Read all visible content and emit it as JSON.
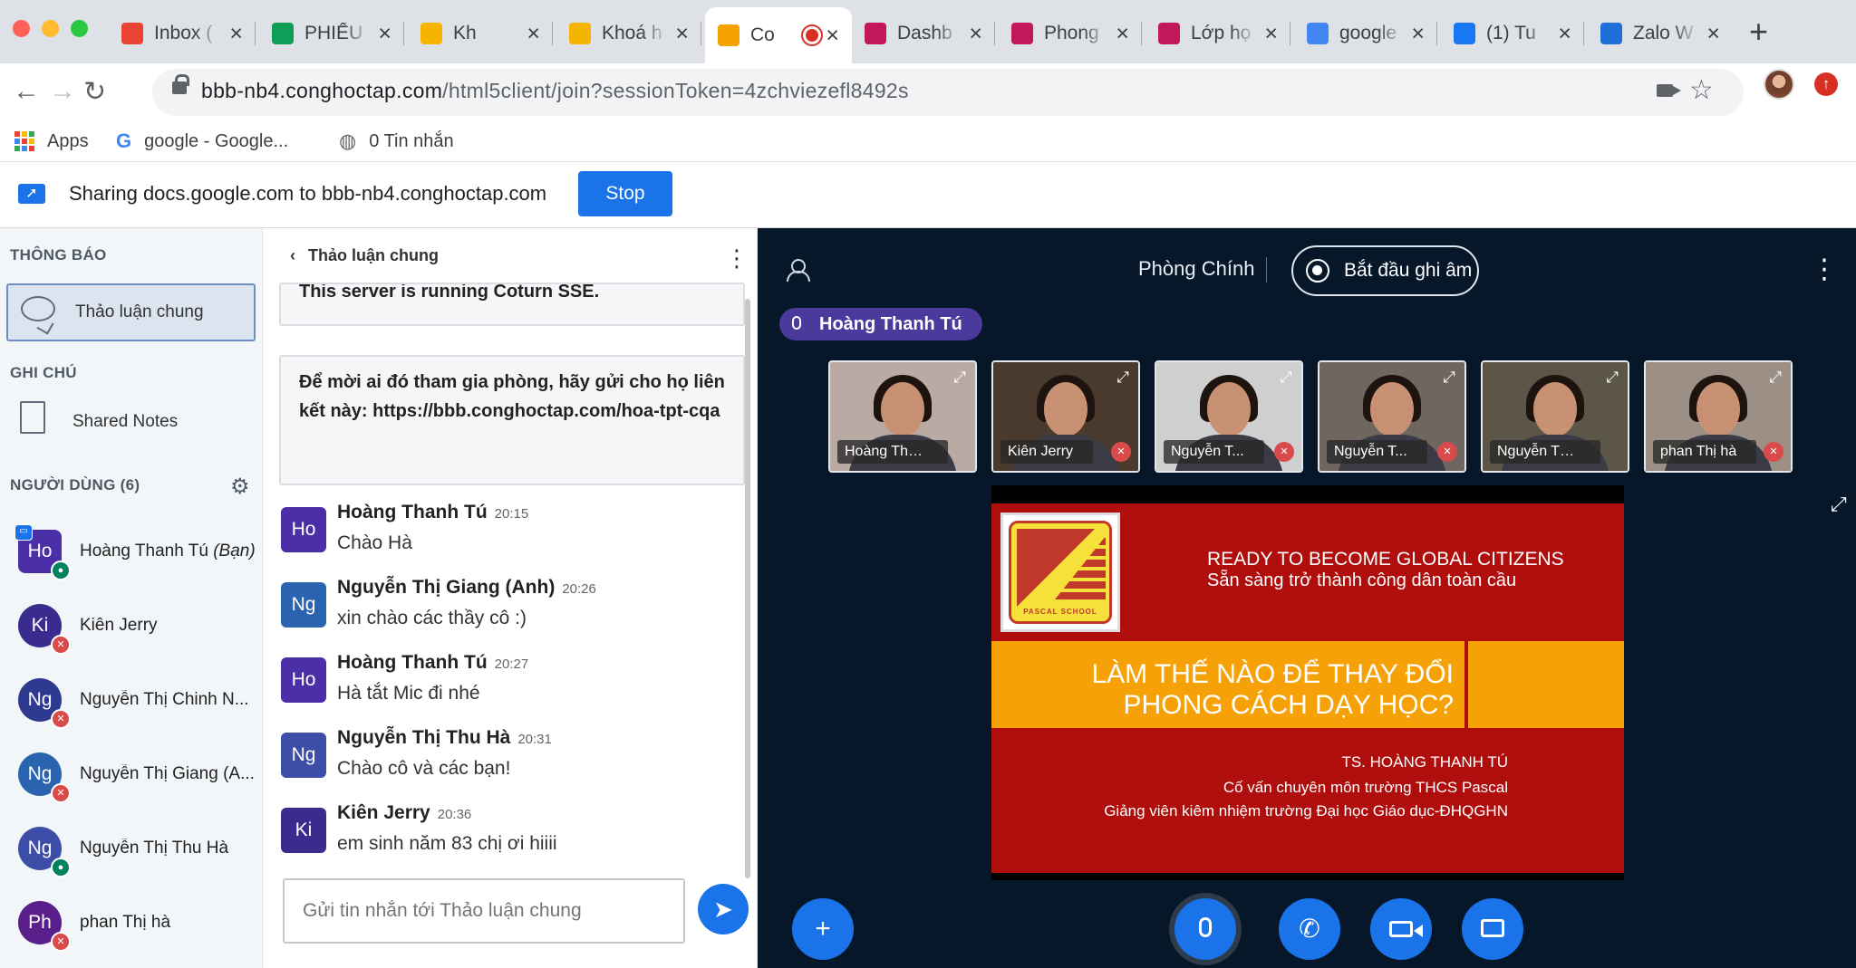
{
  "browser": {
    "tabs": [
      {
        "icon": "gmail-icon",
        "title": "Inbox (",
        "color": "#ea4335"
      },
      {
        "icon": "google-drive-icon",
        "title": "PHIẾU",
        "color": "#0f9d58"
      },
      {
        "icon": "google-slides-icon",
        "title": "Kh",
        "color": "#f4b400"
      },
      {
        "icon": "class-icon",
        "title": "Khoá h",
        "color": "#f4b400"
      },
      {
        "icon": "conghoctap-icon",
        "title": "Co",
        "color": "#f4a300",
        "active": true
      },
      {
        "icon": "dashboard-icon",
        "title": "Dashb",
        "color": "#c2185b"
      },
      {
        "icon": "room-icon",
        "title": "Phong",
        "color": "#c2185b"
      },
      {
        "icon": "class-room-icon",
        "title": "Lớp họ",
        "color": "#c2185b"
      },
      {
        "icon": "google-icon",
        "title": "google",
        "color": "#4285f4"
      },
      {
        "icon": "facebook-icon",
        "title": "(1) Tu",
        "color": "#1877f2"
      },
      {
        "icon": "zalo-icon",
        "title": "Zalo W",
        "color": "#1e6fd9"
      }
    ],
    "url_host": "bbb-nb4.conghoctap.com",
    "url_path": "/html5client/join?sessionToken=4zchviezefl8492s",
    "bookmarks": {
      "apps": "Apps",
      "google": "google - Google...",
      "messages": "0 Tin nhắn"
    }
  },
  "sharing": {
    "text": "Sharing docs.google.com to bbb-nb4.conghoctap.com",
    "stop_label": "Stop"
  },
  "sidebar": {
    "notifications_header": "THÔNG BÁO",
    "public_chat_label": "Thảo luận chung",
    "notes_header": "GHI CHÚ",
    "shared_notes_label": "Shared Notes",
    "users_header": "NGƯỜI DÙNG (6)",
    "users": [
      {
        "initials": "Ho",
        "name": "Hoàng Thanh Tú",
        "you": "(Bạn)",
        "color": "#4b2fa8",
        "status": "mic",
        "presenter": true
      },
      {
        "initials": "Ki",
        "name": "Kiên Jerry",
        "you": "",
        "color": "#3a2c8f",
        "status": "mute"
      },
      {
        "initials": "Ng",
        "name": "Nguyễn Thị Chinh N...",
        "you": "",
        "color": "#2d3a8f",
        "status": "mute"
      },
      {
        "initials": "Ng",
        "name": "Nguyễn Thị Giang (A...",
        "you": "",
        "color": "#2a64b0",
        "status": "mute"
      },
      {
        "initials": "Ng",
        "name": "Nguyễn Thị Thu Hà",
        "you": "",
        "color": "#3d4ea8",
        "status": "mic"
      },
      {
        "initials": "Ph",
        "name": "phan Thị hà",
        "you": "",
        "color": "#5a1f8a",
        "status": "mute"
      }
    ]
  },
  "chat": {
    "title": "Thảo luận chung",
    "system_top": "This server is running Coturn SSE.",
    "welcome": "Để mời ai đó tham gia phòng, hãy gửi cho họ liên kết này: https://bbb.conghoctap.com/hoa-tpt-cqa",
    "messages": [
      {
        "initials": "Ho",
        "name": "Hoàng Thanh Tú",
        "time": "20:15",
        "text": "Chào Hà",
        "color": "#4b2fa8"
      },
      {
        "initials": "Ng",
        "name": "Nguyễn Thị Giang (Anh)",
        "time": "20:26",
        "text": "xin chào các thầy cô :)",
        "color": "#2a64b0"
      },
      {
        "initials": "Ho",
        "name": "Hoàng Thanh Tú",
        "time": "20:27",
        "text": "Hà tắt Mic đi nhé",
        "color": "#4b2fa8"
      },
      {
        "initials": "Ng",
        "name": "Nguyễn Thị Thu Hà",
        "time": "20:31",
        "text": "Chào cô và các bạn!",
        "color": "#3d4ea8"
      },
      {
        "initials": "Ki",
        "name": "Kiên Jerry",
        "time": "20:36",
        "text": "em sinh năm 83 chị ơi hiiii",
        "color": "#3a2c8f"
      }
    ],
    "input_placeholder": "Gửi tin nhắn tới Thảo luận chung"
  },
  "main": {
    "room_name": "Phòng Chính",
    "record_label": "Bắt đầu ghi âm",
    "talking": "Hoàng Thanh Tú",
    "videos": [
      {
        "name": "Hoàng Than...",
        "muted": false,
        "bg": "#b9aaa4"
      },
      {
        "name": "Kiên Jerry",
        "muted": true,
        "bg": "#4a3a2e"
      },
      {
        "name": "Nguyễn T...",
        "muted": true,
        "bg": "#cfcfcf"
      },
      {
        "name": "Nguyễn T...",
        "muted": true,
        "bg": "#6f6660"
      },
      {
        "name": "Nguyễn Thị ...",
        "muted": false,
        "bg": "#5c5648"
      },
      {
        "name": "phan Thị hà",
        "muted": true,
        "bg": "#9c9086"
      }
    ],
    "slide": {
      "logo_text": "PASCAL SCHOOL",
      "line1": "READY TO BECOME GLOBAL CITIZENS",
      "line2": "Sẵn sàng trở thành công dân toàn cầu",
      "title1": "LÀM THẾ NÀO ĐỂ THAY ĐỔI",
      "title2": "PHONG CÁCH DẠY HỌC?",
      "author": "TS. HOÀNG THANH TÚ",
      "role1": "Cố vấn chuyên môn trường THCS Pascal",
      "role2": "Giảng viên kiêm nhiệm trường Đại học Giáo dục-ĐHQGHN"
    }
  }
}
